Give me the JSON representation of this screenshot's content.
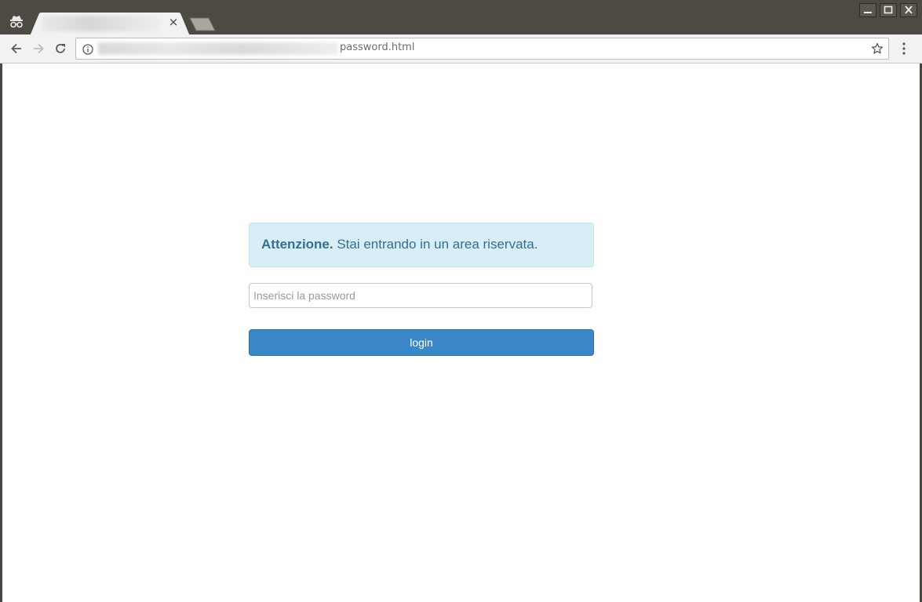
{
  "browser": {
    "tab": {
      "title": "",
      "close_glyph": "×"
    },
    "address": {
      "url_visible": "password.html"
    },
    "icons": {
      "incognito": "incognito-icon",
      "back": "back-arrow-icon",
      "forward": "forward-arrow-icon",
      "reload": "reload-icon",
      "info": "info-icon",
      "star": "star-icon",
      "menu": "kebab-menu-icon"
    },
    "window_controls": [
      "minimize",
      "maximize",
      "close"
    ]
  },
  "page": {
    "alert": {
      "strong": "Attenzione.",
      "message": " Stai entrando in un area riservata."
    },
    "password": {
      "placeholder": "Inserisci la password",
      "value": ""
    },
    "login_button": {
      "label": "login"
    }
  },
  "colors": {
    "alert_bg": "#d9edf7",
    "alert_text": "#31708f",
    "button_bg": "#3c87c8",
    "titlebar": "#4d4943"
  }
}
